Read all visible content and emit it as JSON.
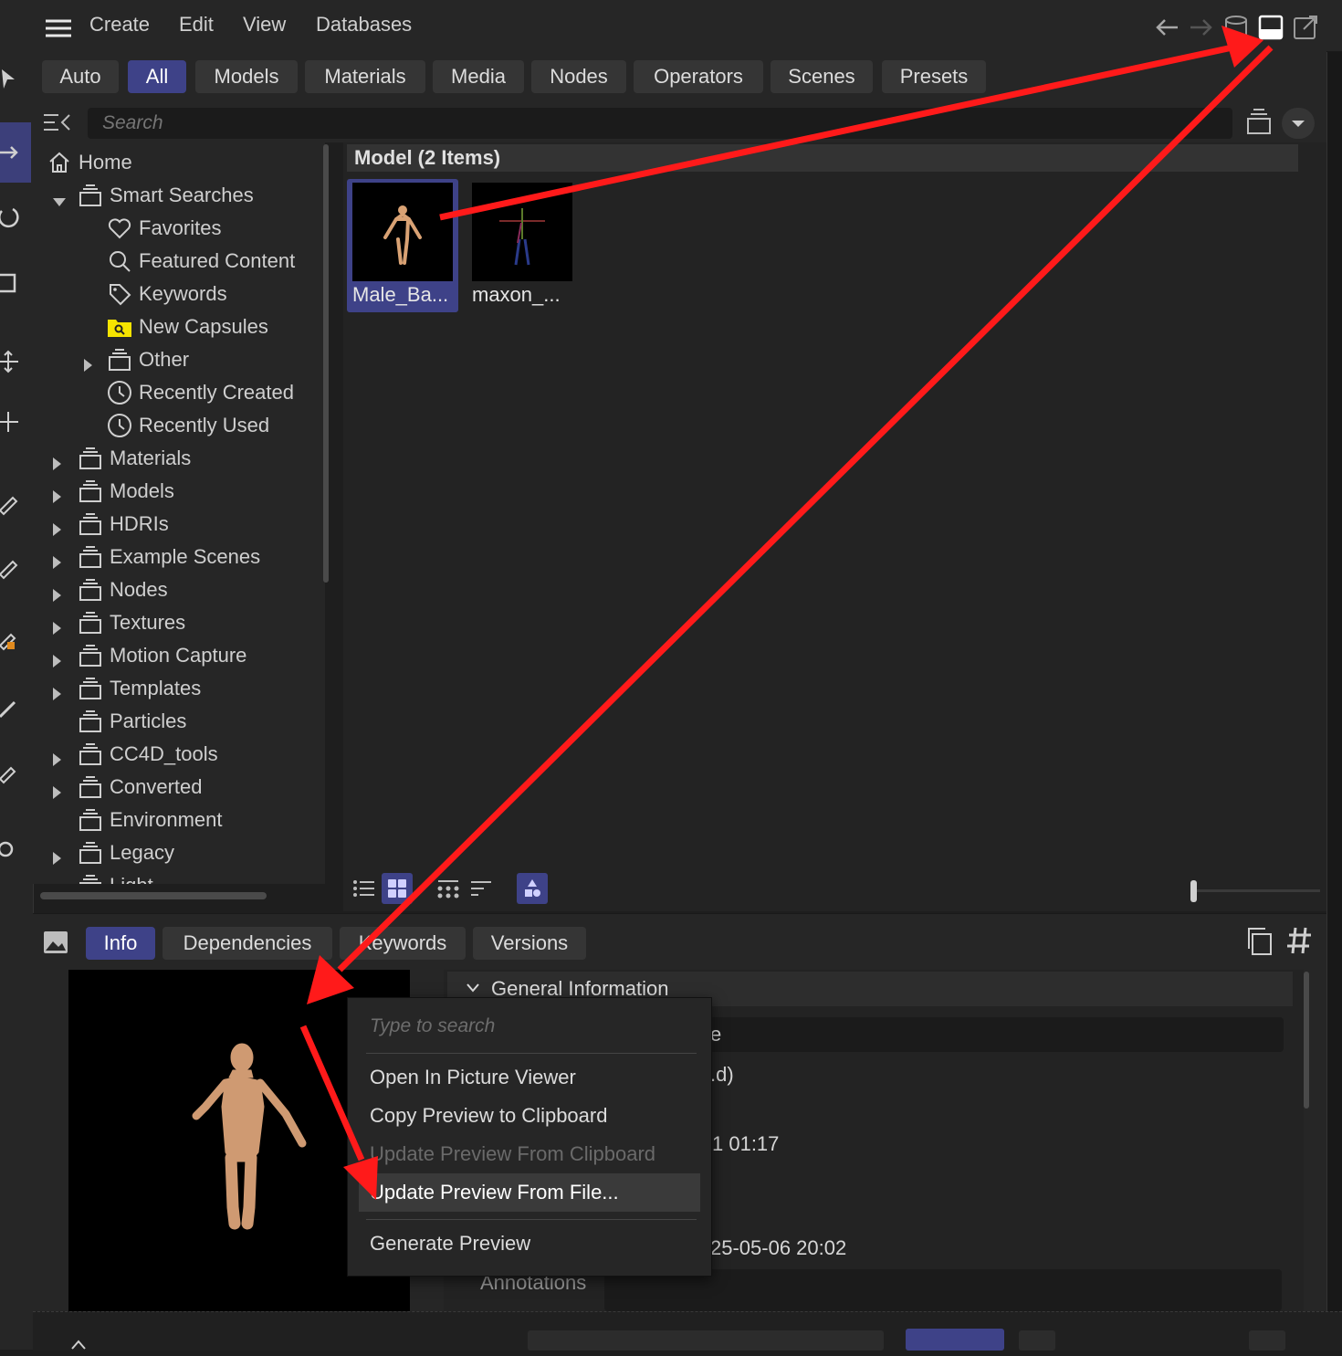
{
  "menubar": {
    "items": [
      "Create",
      "Edit",
      "View",
      "Databases"
    ]
  },
  "filter_tabs": [
    {
      "label": "Auto",
      "active": false
    },
    {
      "label": "All",
      "active": true
    },
    {
      "label": "Models",
      "active": false
    },
    {
      "label": "Materials",
      "active": false
    },
    {
      "label": "Media",
      "active": false
    },
    {
      "label": "Nodes",
      "active": false
    },
    {
      "label": "Operators",
      "active": false
    },
    {
      "label": "Scenes",
      "active": false
    },
    {
      "label": "Presets",
      "active": false
    }
  ],
  "search": {
    "placeholder": "Search"
  },
  "tree": {
    "items": [
      {
        "label": "Home",
        "icon": "home-icon"
      },
      {
        "label": "Smart Searches",
        "icon": "database-icon",
        "expanded": true
      },
      {
        "label": "Favorites",
        "icon": "heart-icon"
      },
      {
        "label": "Featured Content",
        "icon": "magnifier-icon"
      },
      {
        "label": "Keywords",
        "icon": "tag-icon"
      },
      {
        "label": "New Capsules",
        "icon": "capsule-folder-icon"
      },
      {
        "label": "Other",
        "icon": "database-icon"
      },
      {
        "label": "Recently Created",
        "icon": "clock-icon"
      },
      {
        "label": "Recently Used",
        "icon": "clock-icon"
      },
      {
        "label": "Materials",
        "icon": "database-icon"
      },
      {
        "label": "Models",
        "icon": "database-icon"
      },
      {
        "label": "HDRIs",
        "icon": "database-icon"
      },
      {
        "label": "Example Scenes",
        "icon": "database-icon"
      },
      {
        "label": "Nodes",
        "icon": "database-icon"
      },
      {
        "label": "Textures",
        "icon": "database-icon"
      },
      {
        "label": "Motion Capture",
        "icon": "database-icon"
      },
      {
        "label": "Templates",
        "icon": "database-icon"
      },
      {
        "label": "Particles",
        "icon": "database-icon"
      },
      {
        "label": "CC4D_tools",
        "icon": "database-icon"
      },
      {
        "label": "Converted",
        "icon": "database-icon"
      },
      {
        "label": "Environment",
        "icon": "database-icon"
      },
      {
        "label": "Legacy",
        "icon": "database-icon"
      },
      {
        "label": "Light",
        "icon": "database-icon"
      }
    ]
  },
  "content": {
    "group_header": "Model (2 Items)",
    "items": [
      {
        "label": "Male_Ba...",
        "selected": true
      },
      {
        "label": "maxon_...",
        "selected": false
      }
    ]
  },
  "info_tabs": [
    {
      "label": "Info",
      "active": true
    },
    {
      "label": "Dependencies",
      "active": false
    },
    {
      "label": "Keywords",
      "active": false
    },
    {
      "label": "Versions",
      "active": false
    }
  ],
  "properties": {
    "section_title": "General Information",
    "partial_values": [
      "e",
      ".d)",
      "1 01:17",
      "25-05-06 20:02"
    ],
    "annotations_label": "Annotations"
  },
  "context_menu": {
    "search_placeholder": "Type to search",
    "items": [
      {
        "label": "Open In Picture Viewer",
        "enabled": true
      },
      {
        "label": "Copy Preview to Clipboard",
        "enabled": true
      },
      {
        "label": "Update Preview From Clipboard",
        "enabled": false
      },
      {
        "label": "Update Preview From File...",
        "enabled": true,
        "highlighted": true
      },
      {
        "label": "Generate Preview",
        "enabled": true
      }
    ]
  },
  "colors": {
    "accent": "#3e4288",
    "annotation_arrow": "#ff1a1a",
    "capsule_folder": "#f5e400"
  }
}
